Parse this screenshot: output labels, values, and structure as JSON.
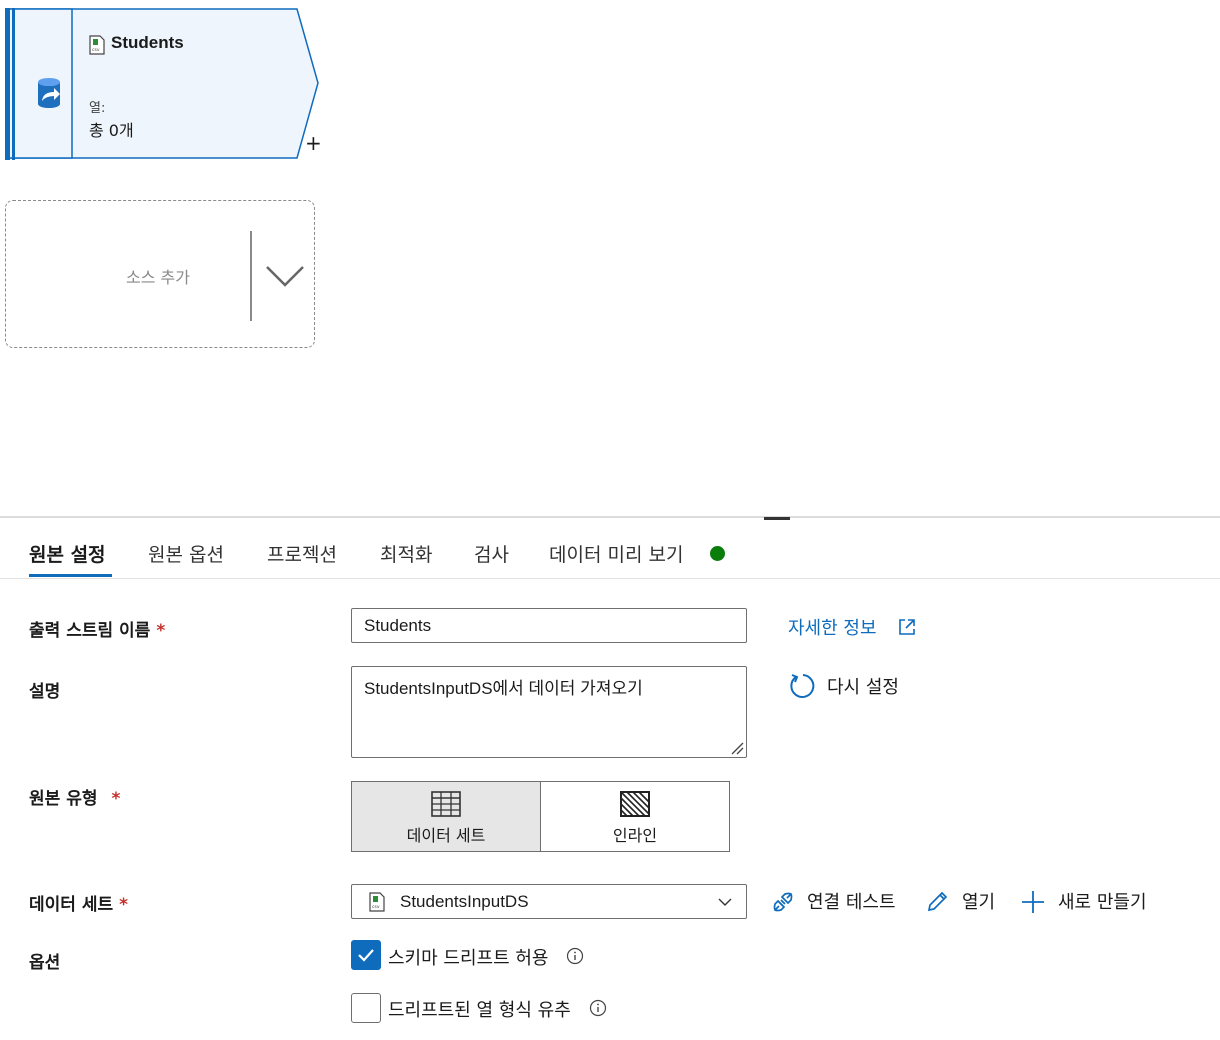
{
  "canvas": {
    "source_node": {
      "title": "Students",
      "columns_label": "열:",
      "columns_value": "총 0개",
      "add_symbol": "+",
      "icon": "database-import-icon",
      "file_icon": "csv-file-icon",
      "accent_color": "#0f6cbd"
    },
    "add_source": {
      "label": "소스 추가",
      "chevron_icon": "chevron-down-icon"
    }
  },
  "tabs": [
    {
      "label": "원본 설정",
      "active": true
    },
    {
      "label": "원본 옵션"
    },
    {
      "label": "프로젝션"
    },
    {
      "label": "최적화"
    },
    {
      "label": "검사"
    },
    {
      "label": "데이터 미리 보기",
      "status_dot_color": "#0b7d0b"
    }
  ],
  "form": {
    "output_stream": {
      "label": "출력 스트림 이름",
      "required_marker": "*",
      "value": "Students"
    },
    "learn_more": {
      "label": "자세한 정보",
      "icon": "external-link-icon"
    },
    "description": {
      "label": "설명",
      "value": "StudentsInputDS에서 데이터 가져오기"
    },
    "reset": {
      "label": "다시 설정",
      "icon": "refresh-icon"
    },
    "source_type": {
      "label": "원본 유형",
      "required_marker": "*",
      "options": [
        {
          "label": "데이터 세트",
          "icon": "table-grid-icon",
          "selected": true
        },
        {
          "label": "인라인",
          "icon": "inline-hatch-icon",
          "selected": false
        }
      ]
    },
    "dataset": {
      "label": "데이터 세트",
      "required_marker": "*",
      "value": "StudentsInputDS",
      "actions": [
        {
          "label": "연결 테스트",
          "icon": "plug-connection-icon"
        },
        {
          "label": "열기",
          "icon": "pencil-icon"
        },
        {
          "label": "새로 만들기",
          "icon": "plus-icon"
        }
      ]
    },
    "options": {
      "label": "옵션",
      "checkboxes": [
        {
          "label": "스키마 드리프트 허용",
          "checked": true
        },
        {
          "label": "드리프트된 열 형식 유추",
          "checked": false
        }
      ]
    }
  }
}
